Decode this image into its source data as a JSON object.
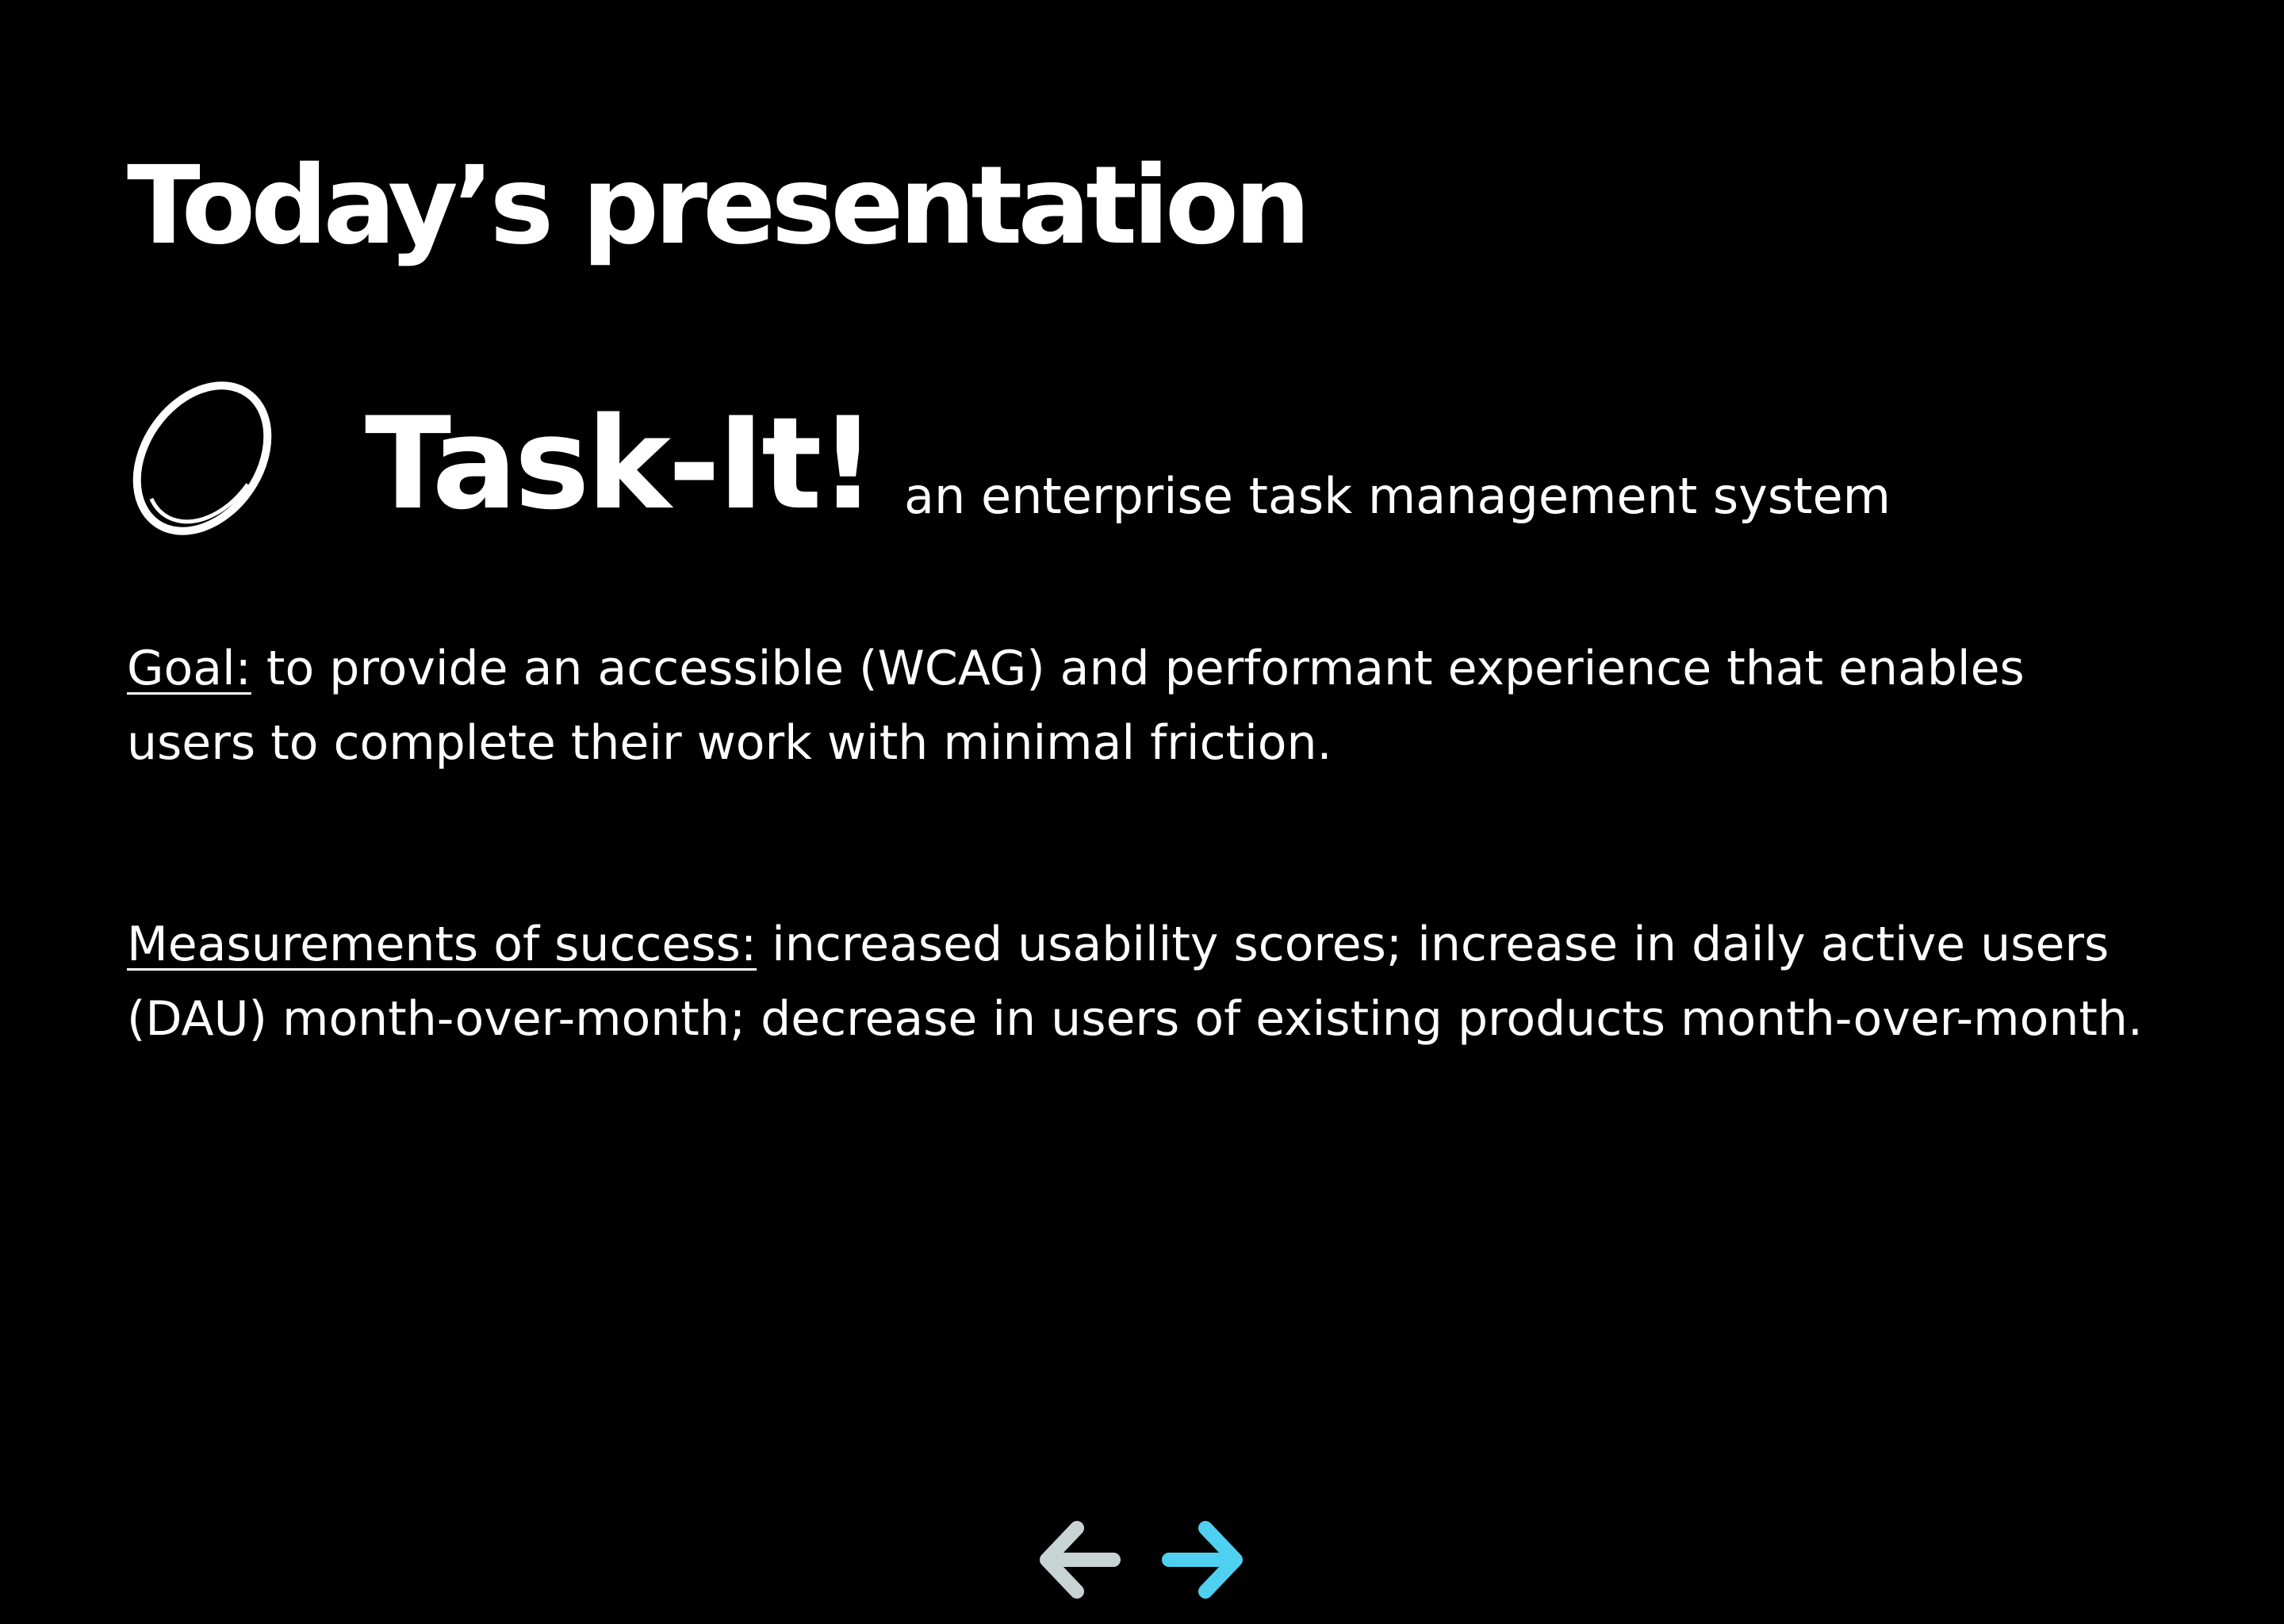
{
  "slide": {
    "title": "Today’s presentation",
    "product_name": "Task-It!",
    "product_tagline": "an enterprise task management system",
    "goal": {
      "term": "Goal:",
      "text": " to provide an accessible (WCAG) and performant experience that enables users to complete their work with minimal friction."
    },
    "measurements": {
      "term": "Measurements of success:",
      "text": " increased usability scores; increase in daily active users (DAU) month-over-month; decrease in users of existing products month-over-month."
    }
  },
  "navigation": {
    "prev_icon": "arrow-left-icon",
    "next_icon": "arrow-right-icon"
  },
  "colors": {
    "background": "#000000",
    "text": "#ffffff",
    "prev_arrow": "#c8d3d3",
    "next_arrow": "#4fd0f0"
  }
}
